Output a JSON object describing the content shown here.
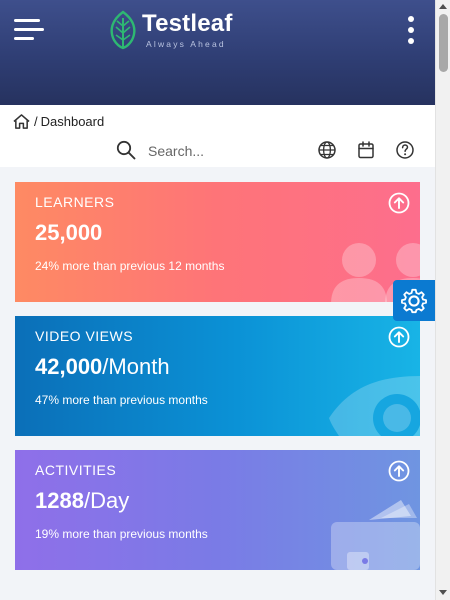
{
  "header": {
    "brand": "Testleaf",
    "tagline": "Always Ahead",
    "menu_icon": "hamburger-menu-icon",
    "more_icon": "more-vertical-icon"
  },
  "breadcrumb": {
    "home_icon": "home-icon",
    "separator": "/",
    "current": "Dashboard"
  },
  "search": {
    "placeholder": "Search...",
    "value": ""
  },
  "toolbar": {
    "icons": [
      "globe-icon",
      "calendar-icon",
      "help-icon"
    ]
  },
  "cards": [
    {
      "title": "LEARNERS",
      "value": "25,000",
      "unit": "",
      "subtitle": "24% more than previous 12 months",
      "icon": "users-icon",
      "colors": [
        "#fe8a63",
        "#fd6e8d"
      ]
    },
    {
      "title": "VIDEO VIEWS",
      "value": "42,000",
      "unit": "/Month",
      "subtitle": "47% more than previous months",
      "icon": "eye-icon",
      "colors": [
        "#0b6fb8",
        "#18b4e6"
      ]
    },
    {
      "title": "ACTIVITIES",
      "value": "1288",
      "unit": "/Day",
      "subtitle": "19% more than previous months",
      "icon": "wallet-icon",
      "colors": [
        "#8f6fe9",
        "#6f95e1"
      ]
    }
  ],
  "settings_icon": "gear-icon",
  "colors": {
    "header_top": "#3e4f8c",
    "header_bottom": "#26325f",
    "accent": "#0b7ad1",
    "logo_green": "#2eb872"
  }
}
